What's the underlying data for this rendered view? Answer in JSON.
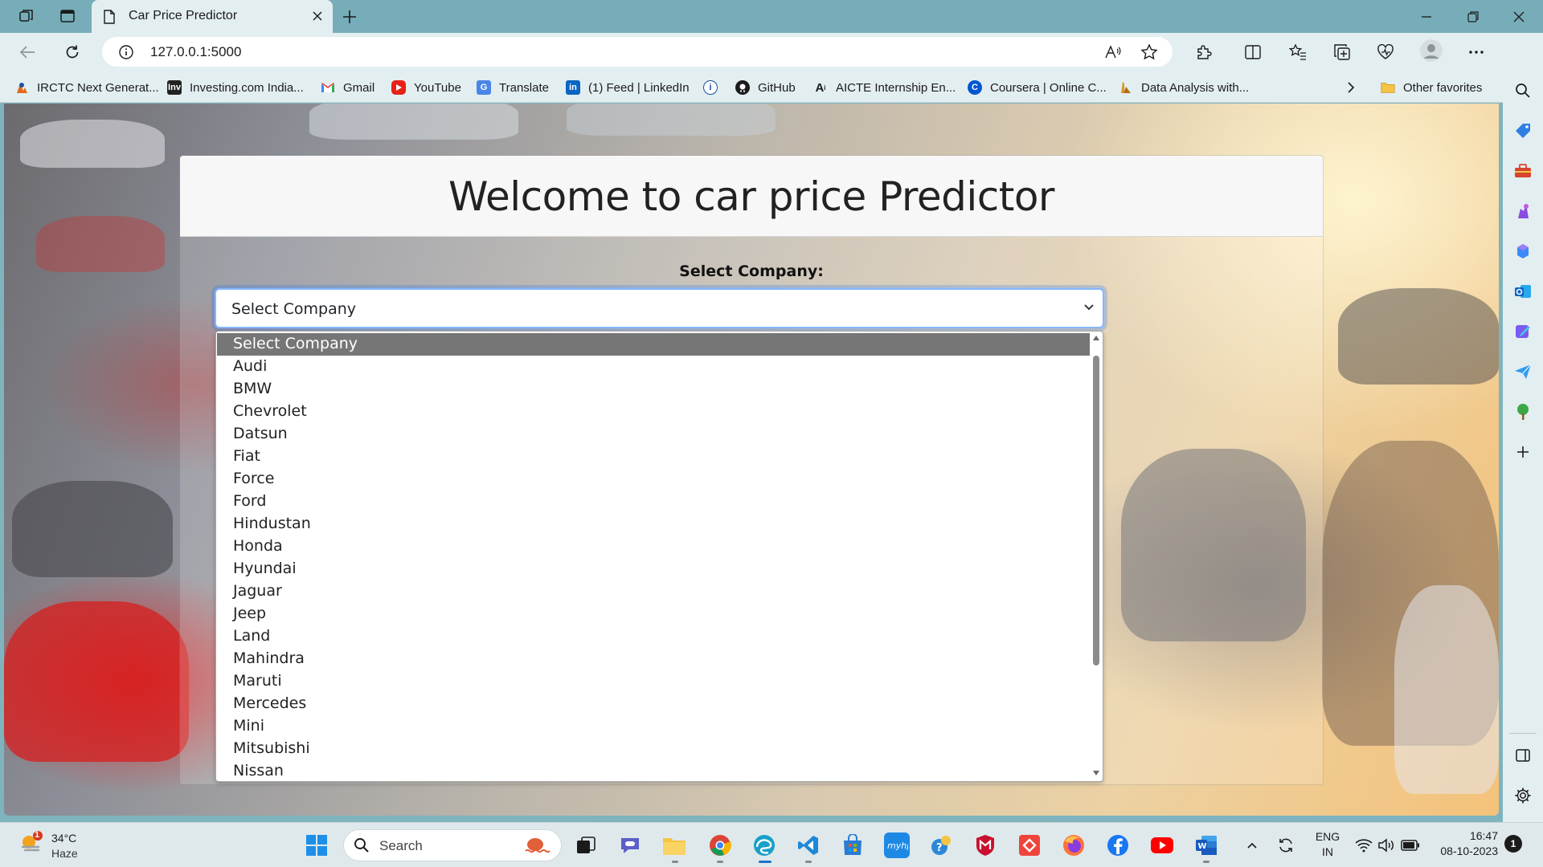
{
  "browser": {
    "tab_title": "Car Price Predictor",
    "url": "127.0.0.1:5000",
    "accent": "#76adb9"
  },
  "bookmarks": [
    {
      "label": "IRCTC Next Generat...",
      "icon": "irctc-icon"
    },
    {
      "label": "Investing.com India...",
      "icon": "investing-icon"
    },
    {
      "label": "Gmail",
      "icon": "gmail-icon"
    },
    {
      "label": "YouTube",
      "icon": "youtube-icon"
    },
    {
      "label": "Translate",
      "icon": "translate-icon"
    },
    {
      "label": "(1) Feed | LinkedIn",
      "icon": "linkedin-icon"
    },
    {
      "label": "",
      "icon": "info-bookmark-icon"
    },
    {
      "label": "GitHub",
      "icon": "github-icon"
    },
    {
      "label": "AICTE Internship En...",
      "icon": "aicte-icon"
    },
    {
      "label": "Coursera | Online C...",
      "icon": "coursera-icon"
    },
    {
      "label": "Data Analysis with...",
      "icon": "data-analysis-icon"
    }
  ],
  "other_favorites": "Other favorites",
  "page": {
    "heading": "Welcome to car price Predictor",
    "company_label": "Select Company:",
    "company_select_value": "Select Company",
    "company_options": [
      "Select Company",
      "Audi",
      "BMW",
      "Chevrolet",
      "Datsun",
      "Fiat",
      "Force",
      "Ford",
      "Hindustan",
      "Honda",
      "Hyundai",
      "Jaguar",
      "Jeep",
      "Land",
      "Mahindra",
      "Maruti",
      "Mercedes",
      "Mini",
      "Mitsubishi",
      "Nissan"
    ]
  },
  "taskbar": {
    "weather_temp": "34°C",
    "weather_cond": "Haze",
    "weather_badge": "1",
    "search_placeholder": "Search",
    "lang_top": "ENG",
    "lang_bottom": "IN",
    "time": "16:47",
    "date": "08-10-2023",
    "notif_count": "1"
  }
}
